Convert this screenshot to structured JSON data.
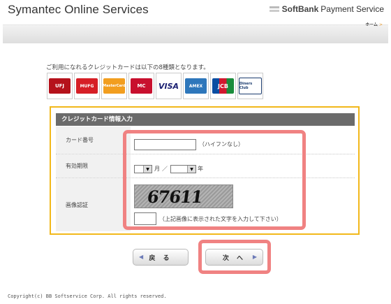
{
  "header": {
    "title": "Symantec Online Services",
    "logo_softbank": "SoftBank",
    "logo_payment": "Payment Service",
    "home_link": "ホーム"
  },
  "intro_text": "ご利用になれるクレジットカードは以下の8種類となります。",
  "cards": [
    {
      "name": "UFJ",
      "label": "UFJ",
      "color": "#b5121b"
    },
    {
      "name": "MUFG CARD",
      "label": "MUFG",
      "color": "#d61f26"
    },
    {
      "name": "MasterCard",
      "label": "MasterCard",
      "color": "#f29e1f"
    },
    {
      "name": "MILLION CARD",
      "label": "MC",
      "color": "#c8102e"
    },
    {
      "name": "VISA",
      "label": "VISA",
      "color": "#1a1f71"
    },
    {
      "name": "American Express",
      "label": "AMEX",
      "color": "#2e77bb"
    },
    {
      "name": "JCB",
      "label": "JCB",
      "color": "#0b4ea2"
    },
    {
      "name": "Diners Club International",
      "label": "Diners Club",
      "color": "#1a3b6e"
    }
  ],
  "form": {
    "heading": "クレジットカード情報入力",
    "card_number_label": "カード番号",
    "card_number_value": "",
    "card_number_note": "（ハイフンなし）",
    "expiry_label": "有効期限",
    "expiry_month_value": "",
    "expiry_month_unit": "月",
    "expiry_separator": "／",
    "expiry_year_value": "",
    "expiry_year_unit": "年",
    "captcha_label": "画像認証",
    "captcha_text": "67611",
    "captcha_input_value": "",
    "captcha_note": "（上記画像に表示された文字を入力して下さい）"
  },
  "buttons": {
    "back": "戻 る",
    "next": "次 へ"
  },
  "footer": {
    "copyright": "Copyright(c) BB Softservice Corp. All rights reserved."
  },
  "colors": {
    "form_border": "#f2b81a",
    "highlight": "#f08282",
    "form_heading_bg": "#6b6b6b"
  }
}
